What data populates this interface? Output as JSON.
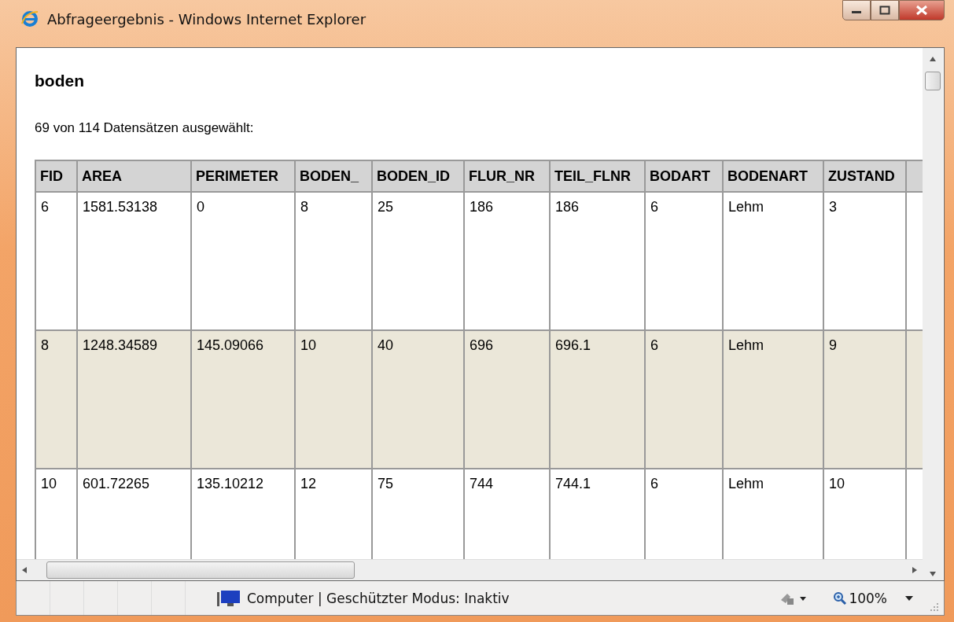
{
  "window": {
    "title": "Abfrageergebnis - Windows Internet Explorer"
  },
  "page": {
    "heading": "boden",
    "summary": "69 von 114 Datensätzen ausgewählt:"
  },
  "table": {
    "columns": [
      "FID",
      "AREA",
      "PERIMETER",
      "BODEN_",
      "BODEN_ID",
      "FLUR_NR",
      "TEIL_FLNR",
      "BODART",
      "BODENART",
      "ZUSTAND"
    ],
    "rows": [
      {
        "selected": false,
        "cells": [
          "6",
          "1581.53138",
          "0",
          "8",
          "25",
          "186",
          "186",
          "6",
          "Lehm",
          "3"
        ]
      },
      {
        "selected": true,
        "cells": [
          "8",
          "1248.34589",
          "145.09066",
          "10",
          "40",
          "696",
          "696.1",
          "6",
          "Lehm",
          "9"
        ]
      },
      {
        "selected": false,
        "cells": [
          "10",
          "601.72265",
          "135.10212",
          "12",
          "75",
          "744",
          "744.1",
          "6",
          "Lehm",
          "10"
        ]
      }
    ]
  },
  "status_bar": {
    "zone": "Computer | Geschützter Modus: Inaktiv",
    "zoom": "100%"
  }
}
